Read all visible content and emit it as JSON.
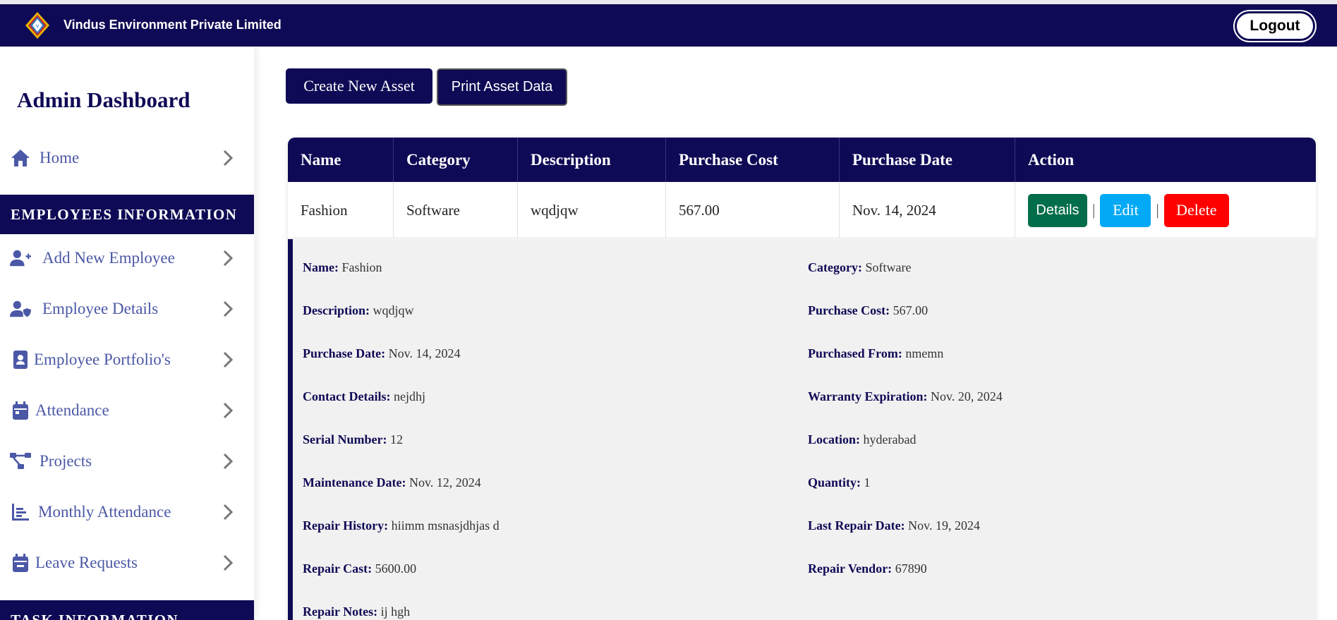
{
  "header": {
    "company_name": "Vindus Environment Private Limited",
    "logout_label": "Logout"
  },
  "sidebar": {
    "title": "Admin Dashboard",
    "home": {
      "label": "Home",
      "icon": "home-icon"
    },
    "sections": [
      {
        "heading": "EMPLOYEES INFORMATION",
        "items": [
          {
            "label": "Add New Employee",
            "icon": "user-plus-icon"
          },
          {
            "label": "Employee Details",
            "icon": "user-shield-icon"
          },
          {
            "label": "Employee Portfolio's",
            "icon": "id-badge-icon"
          },
          {
            "label": "Attendance",
            "icon": "calendar-icon"
          },
          {
            "label": "Projects",
            "icon": "project-diagram-icon"
          },
          {
            "label": "Monthly Attendance",
            "icon": "chart-icon"
          },
          {
            "label": "Leave Requests",
            "icon": "calendar-minus-icon"
          }
        ]
      },
      {
        "heading": "TASK INFORMATION",
        "items": []
      }
    ]
  },
  "toolbar": {
    "create_label": "Create New Asset",
    "print_label": "Print Asset Data"
  },
  "table": {
    "columns": [
      "Name",
      "Category",
      "Description",
      "Purchase Cost",
      "Purchase Date",
      "Action"
    ],
    "rows": [
      {
        "name": "Fashion",
        "category": "Software",
        "description": "wqdjqw",
        "purchase_cost": "567.00",
        "purchase_date": "Nov. 14, 2024",
        "actions": {
          "details": "Details",
          "separator": "|",
          "edit": "Edit",
          "delete": "Delete"
        }
      }
    ]
  },
  "details": {
    "fields": [
      {
        "label": "Name:",
        "value": "Fashion"
      },
      {
        "label": "Category:",
        "value": "Software"
      },
      {
        "label": "Description:",
        "value": "wqdjqw"
      },
      {
        "label": "Purchase Cost:",
        "value": "567.00"
      },
      {
        "label": "Purchase Date:",
        "value": "Nov. 14, 2024"
      },
      {
        "label": "Purchased From:",
        "value": "nmemn"
      },
      {
        "label": "Contact Details:",
        "value": "nejdhj"
      },
      {
        "label": "Warranty Expiration:",
        "value": "Nov. 20, 2024"
      },
      {
        "label": "Serial Number:",
        "value": "12"
      },
      {
        "label": "Location:",
        "value": "hyderabad"
      },
      {
        "label": "Maintenance Date:",
        "value": "Nov. 12, 2024"
      },
      {
        "label": "Quantity:",
        "value": "1"
      },
      {
        "label": "Repair History:",
        "value": "hiimm msnasjdhjas d"
      },
      {
        "label": "Last Repair Date:",
        "value": "Nov. 19, 2024"
      },
      {
        "label": "Repair Cast:",
        "value": "5600.00"
      },
      {
        "label": "Repair Vendor:",
        "value": "67890"
      },
      {
        "label": "Repair Notes:",
        "value": "ij hgh"
      }
    ]
  },
  "colors": {
    "brand_navy": "#0f0a55",
    "sidebar_text": "#4b58a6",
    "details_button": "#016d4b",
    "edit_button": "#03a9f4",
    "delete_button": "#fe0000",
    "details_background": "#f1f1f1"
  }
}
